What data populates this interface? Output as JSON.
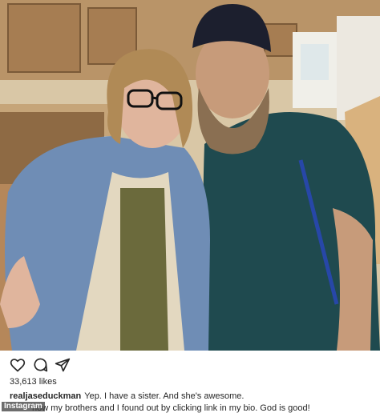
{
  "post": {
    "likes_text": "33,613 likes",
    "username": "realjaseduckman",
    "caption_line1": "Yep. I have a sister. And she's awesome.",
    "caption_line2": "now my brothers and I found out by clicking link in my bio. God is good!"
  },
  "watermark": "Instagram",
  "actions": {
    "icons": [
      "heart-icon",
      "comment-icon",
      "share-icon"
    ]
  },
  "photo": {
    "subject": "photo"
  },
  "colors": {
    "text": "#262626",
    "background": "#ffffff"
  }
}
